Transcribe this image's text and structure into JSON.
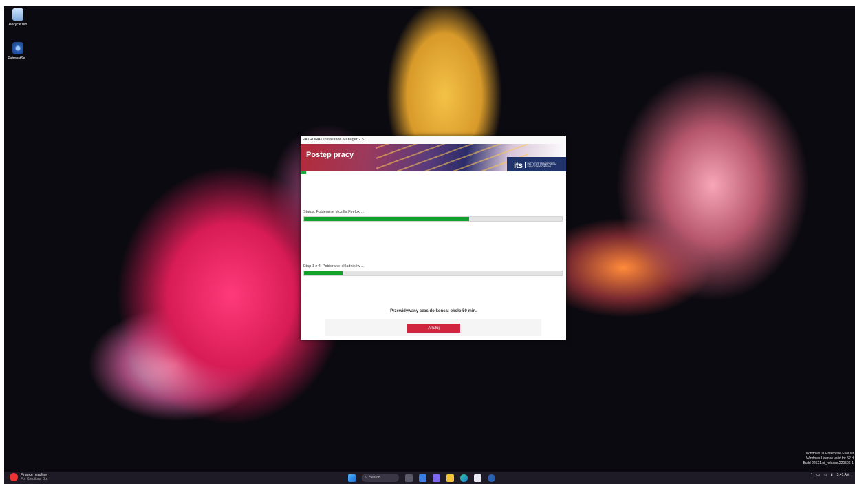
{
  "desktop": {
    "icons": [
      {
        "label": "Recycle Bin",
        "icon": "recycle-bin-icon"
      },
      {
        "label": "PatronatSe...",
        "icon": "app-shortcut-icon"
      }
    ],
    "watermark": {
      "line1": "Windows 11 Enterprise Evaluat",
      "line2": "Windows License valid for 52 d",
      "line3": "Build 22621.ni_release.220506-1"
    }
  },
  "installer": {
    "window_title": "PATRONAT Installation Manager 2.5",
    "banner_title": "Postęp pracy",
    "logo_text": "its",
    "logo_subtext": "INSTYTUT TRANSPORTU SAMOCHODOWEGO",
    "top_progress": 0.02,
    "status_label": "Status: Pobieranie Mozilla Firefox ...",
    "status_progress": 0.64,
    "stage_label": "Etap 1 z 4: Pobieranie składników ...",
    "stage_progress": 0.15,
    "eta_text": "Przewidywany czas do końca: około 50 min.",
    "cancel_label": "Anuluj",
    "accent_color": "#d0243f",
    "progress_color": "#12a12c"
  },
  "taskbar": {
    "news_title": "Finance headline",
    "news_subtitle": "For Creditors, Bot",
    "search_label": "Search",
    "clock_time": "3:41 AM",
    "apps": [
      "start-icon",
      "search-icon",
      "task-view-icon",
      "widgets-icon",
      "chat-icon",
      "file-explorer-icon",
      "edge-icon",
      "store-icon",
      "patronat-icon"
    ]
  }
}
